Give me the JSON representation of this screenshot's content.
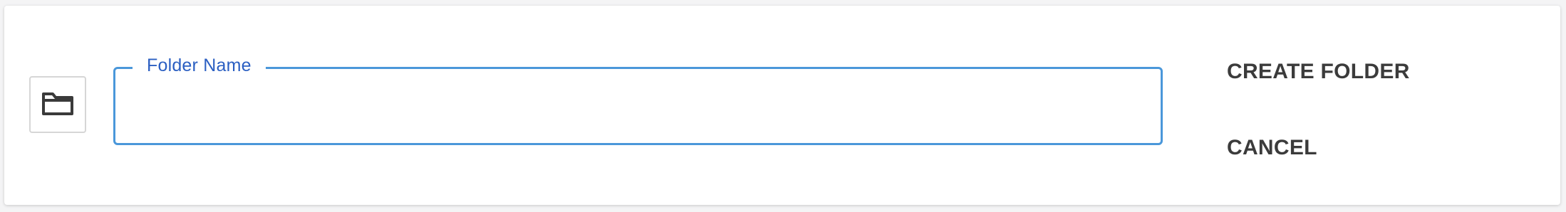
{
  "folder_icon": "folder-icon",
  "field": {
    "label": "Folder Name",
    "value": "",
    "placeholder": ""
  },
  "actions": {
    "create_label": "CREATE FOLDER",
    "cancel_label": "CANCEL"
  },
  "colors": {
    "field_border": "#4a97da",
    "field_label": "#2b5fc2",
    "button_text": "#3b3b3b"
  }
}
